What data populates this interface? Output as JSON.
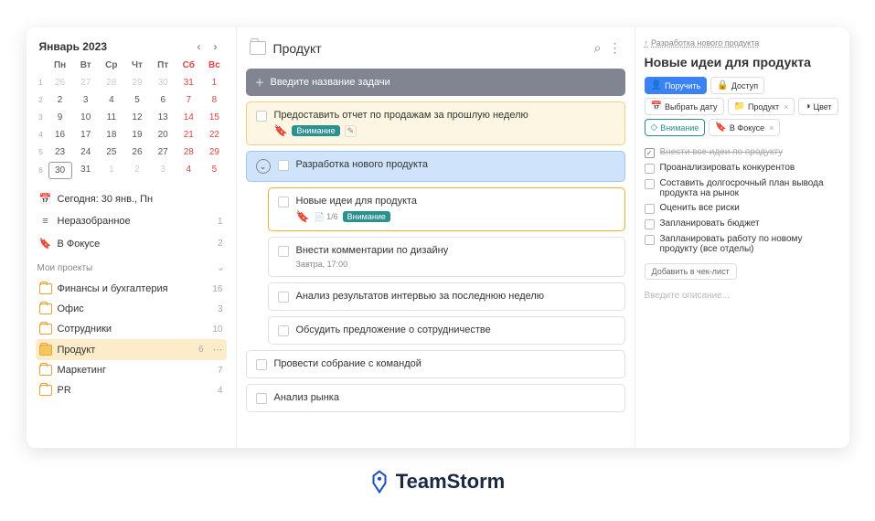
{
  "calendar": {
    "title": "Январь 2023",
    "dow": [
      "Пн",
      "Вт",
      "Ср",
      "Чт",
      "Пт",
      "Сб",
      "Вс"
    ],
    "weeks": [
      {
        "num": "1",
        "days": [
          {
            "d": "26",
            "o": 1
          },
          {
            "d": "27",
            "o": 1
          },
          {
            "d": "28",
            "o": 1
          },
          {
            "d": "29",
            "o": 1
          },
          {
            "d": "30",
            "o": 1
          },
          {
            "d": "31",
            "o": 1,
            "we": 1
          },
          {
            "d": "1",
            "we": 1
          }
        ]
      },
      {
        "num": "2",
        "days": [
          {
            "d": "2"
          },
          {
            "d": "3"
          },
          {
            "d": "4"
          },
          {
            "d": "5"
          },
          {
            "d": "6"
          },
          {
            "d": "7",
            "we": 1
          },
          {
            "d": "8",
            "we": 1
          }
        ]
      },
      {
        "num": "3",
        "days": [
          {
            "d": "9"
          },
          {
            "d": "10"
          },
          {
            "d": "11"
          },
          {
            "d": "12"
          },
          {
            "d": "13"
          },
          {
            "d": "14",
            "we": 1
          },
          {
            "d": "15",
            "we": 1
          }
        ]
      },
      {
        "num": "4",
        "days": [
          {
            "d": "16"
          },
          {
            "d": "17"
          },
          {
            "d": "18"
          },
          {
            "d": "19"
          },
          {
            "d": "20"
          },
          {
            "d": "21",
            "we": 1
          },
          {
            "d": "22",
            "we": 1
          }
        ]
      },
      {
        "num": "5",
        "days": [
          {
            "d": "23"
          },
          {
            "d": "24"
          },
          {
            "d": "25"
          },
          {
            "d": "26"
          },
          {
            "d": "27"
          },
          {
            "d": "28",
            "we": 1
          },
          {
            "d": "29",
            "we": 1
          }
        ]
      },
      {
        "num": "6",
        "days": [
          {
            "d": "30",
            "sel": 1
          },
          {
            "d": "31"
          },
          {
            "d": "1",
            "o": 1
          },
          {
            "d": "2",
            "o": 1
          },
          {
            "d": "3",
            "o": 1
          },
          {
            "d": "4",
            "o": 1,
            "we": 1
          },
          {
            "d": "5",
            "o": 1,
            "we": 1
          }
        ]
      }
    ]
  },
  "side_links": [
    {
      "icon": "📅",
      "label": "Сегодня: 30 янв., Пн",
      "count": ""
    },
    {
      "icon": "≡",
      "label": "Неразобранное",
      "count": "1"
    },
    {
      "icon": "🔖",
      "label": "В Фокусе",
      "count": "2",
      "bookmark": 1
    }
  ],
  "side_section": "Мои проекты",
  "projects": [
    {
      "label": "Финансы и бухгалтерия",
      "count": "16"
    },
    {
      "label": "Офис",
      "count": "3"
    },
    {
      "label": "Сотрудники",
      "count": "10"
    },
    {
      "label": "Продукт",
      "count": "6",
      "active": 1
    },
    {
      "label": "Маркетинг",
      "count": "7"
    },
    {
      "label": "PR",
      "count": "4"
    }
  ],
  "center": {
    "title": "Продукт",
    "new_task_placeholder": "Введите название задачи",
    "tasks": [
      {
        "title": "Предоставить отчет по продажам за прошлую неделю",
        "yellow": 1,
        "bookmark": 1,
        "tag": "Внимание",
        "edit": 1
      },
      {
        "title": "Разработка нового продукта",
        "blue": 1,
        "expand": 1,
        "children": [
          {
            "title": "Новые идеи для продукта",
            "highlight": 1,
            "bookmark": 1,
            "sub": "1/6",
            "tag": "Внимание"
          },
          {
            "title": "Внести комментарии по дизайну",
            "sub": "Завтра, 17:00"
          },
          {
            "title": "Анализ результатов интервью за последнюю неделю"
          },
          {
            "title": "Обсудить предложение о сотрудничестве"
          }
        ]
      },
      {
        "title": "Провести собрание с командой"
      },
      {
        "title": "Анализ рынка"
      }
    ]
  },
  "right": {
    "crumb_icon": "↑",
    "crumb": "Разработка нового продукта",
    "title": "Новые идеи для продукта",
    "buttons": [
      {
        "icon": "👤",
        "label": "Поручить",
        "primary": 1
      },
      {
        "icon": "🔒",
        "label": "Доступ"
      },
      {
        "icon": "📅",
        "label": "Выбрать дату"
      },
      {
        "icon": "📁",
        "label": "Продукт",
        "x": 1
      },
      {
        "icon": "◑",
        "label": "Цвет"
      },
      {
        "icon": "◇",
        "label": "Внимание",
        "attn": 1
      },
      {
        "icon": "🔖",
        "label": "В Фокусе",
        "focus": 1,
        "x": 1
      }
    ],
    "checklist": [
      {
        "label": "Внести все идеи по продукту",
        "done": 1
      },
      {
        "label": "Проанализировать конкурентов"
      },
      {
        "label": "Составить долгосрочный план вывода продукта на рынок"
      },
      {
        "label": "Оценить все риски"
      },
      {
        "label": "Запланировать бюджет"
      },
      {
        "label": "Запланировать работу по новому продукту (все отделы)"
      }
    ],
    "add_checklist": "Добавить в чек-лист",
    "desc_placeholder": "Введите описание..."
  },
  "brand": "TeamStorm"
}
